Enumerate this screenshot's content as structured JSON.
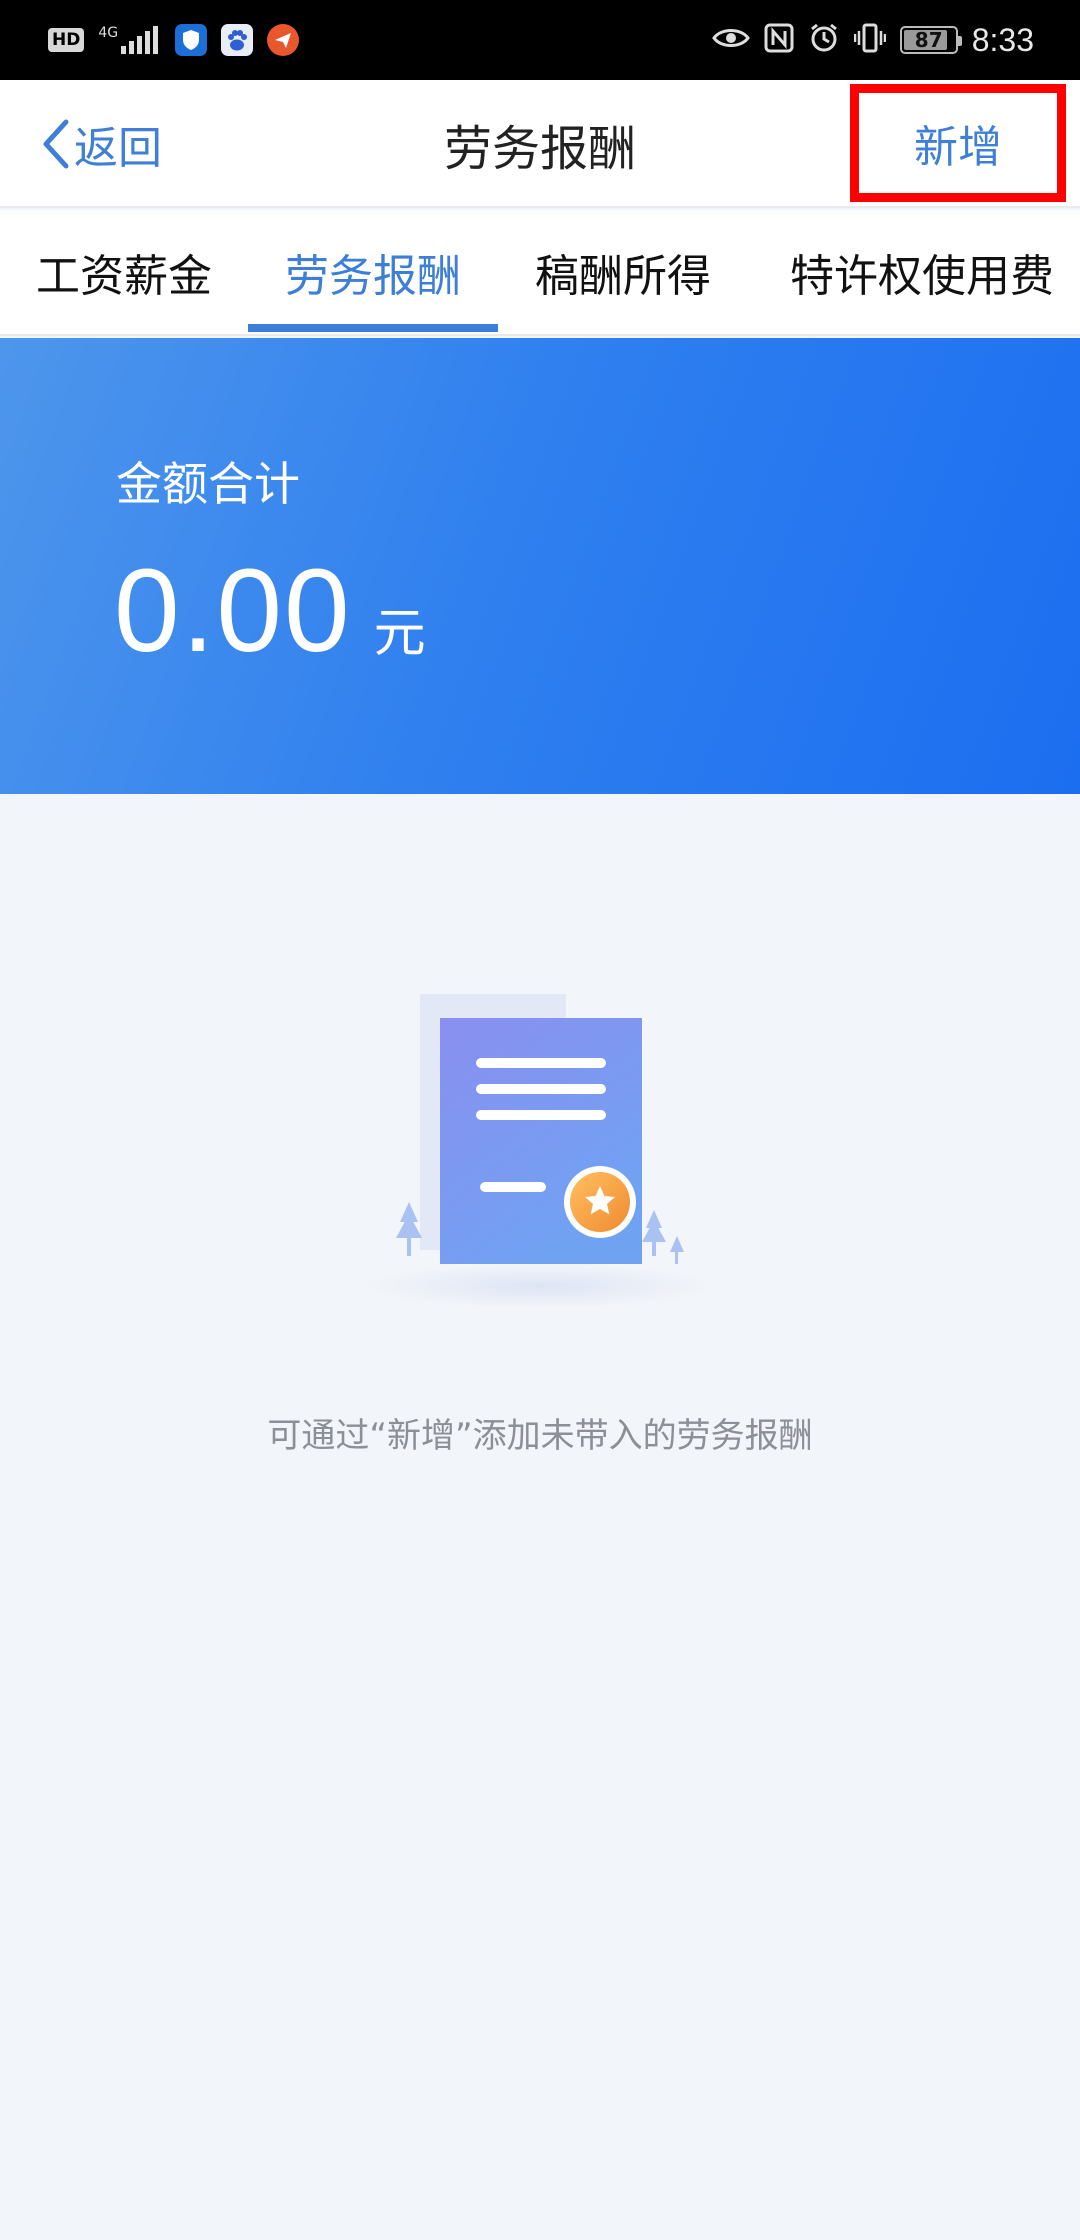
{
  "status_bar": {
    "hd_label": "HD",
    "network_label": "4G",
    "battery_level": 87,
    "battery_text": "87",
    "time": "8:33",
    "icons": [
      "hd-icon",
      "signal-icon",
      "shield-app-icon",
      "baidu-app-icon",
      "paper-plane-app-icon",
      "eye-icon",
      "nfc-icon",
      "alarm-icon",
      "vibrate-icon",
      "battery-icon"
    ]
  },
  "nav": {
    "back_label": "返回",
    "title": "劳务报酬",
    "add_label": "新增"
  },
  "tabs": [
    {
      "label": "工资薪金",
      "active": false
    },
    {
      "label": "劳务报酬",
      "active": true
    },
    {
      "label": "稿酬所得",
      "active": false
    },
    {
      "label": "特许权使用费",
      "active": false
    }
  ],
  "summary": {
    "label": "金额合计",
    "value": "0.00",
    "unit": "元"
  },
  "empty_state": {
    "illustration": "document-certificate-illustration",
    "message": "可通过“新增”添加未带入的劳务报酬"
  },
  "colors": {
    "accent": "#3d7ed8",
    "banner_start": "#4e96ec",
    "banner_end": "#1c6ef0",
    "highlight_box": "#ff0000",
    "background": "#f2f5f9"
  }
}
